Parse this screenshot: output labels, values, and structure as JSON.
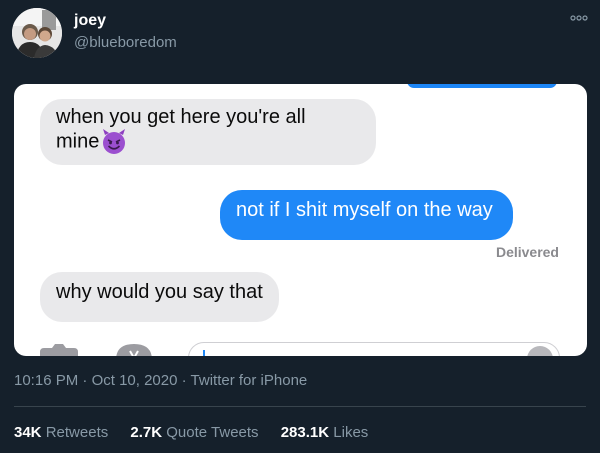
{
  "author": {
    "display_name": "joey",
    "handle": "@blueboredom"
  },
  "conversation": {
    "messages": [
      {
        "direction": "incoming",
        "text_line1": "when you get here you're all",
        "text_line2": "mine",
        "emoji": "smiling-imp-emoji"
      },
      {
        "direction": "outgoing",
        "text": "not if I shit myself on the way"
      },
      {
        "direction": "incoming",
        "text": "why would you say that"
      }
    ],
    "status": "Delivered"
  },
  "meta": {
    "time": "10:16 PM",
    "date": "Oct 10, 2020",
    "separator": "·",
    "source": "Twitter for iPhone"
  },
  "stats": {
    "retweets_count": "34K",
    "retweets_label": "Retweets",
    "quotes_count": "2.7K",
    "quotes_label": "Quote Tweets",
    "likes_count": "283.1K",
    "likes_label": "Likes"
  },
  "colors": {
    "background": "#15202b",
    "outgoing_bubble": "#1f88f7",
    "incoming_bubble": "#e9e9eb",
    "muted_text": "#8899a6"
  }
}
